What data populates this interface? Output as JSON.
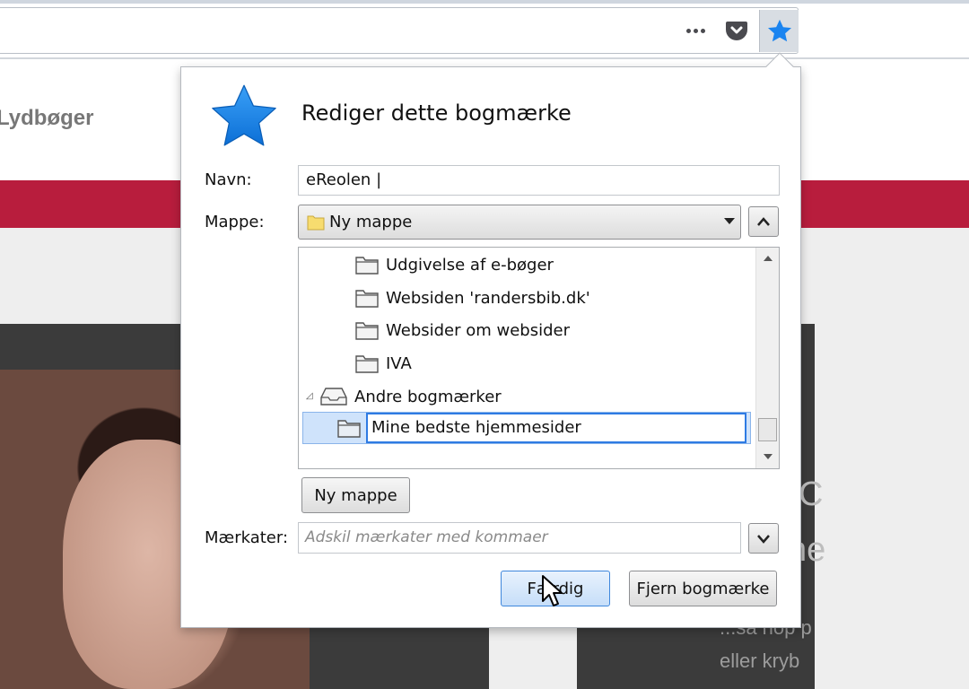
{
  "page_behind": {
    "nav_text": "Lydbøger",
    "right_heading_1": "C",
    "right_heading_2": "ne",
    "right_text_1": "...så hop p",
    "right_text_2": "eller kryb"
  },
  "toolbar": {
    "more_icon": "ellipsis-icon",
    "pocket_icon": "pocket-icon",
    "bookmark_icon": "star-icon",
    "accent_color": "#1a84f0"
  },
  "bookmark_panel": {
    "title": "Rediger dette bogmærke",
    "name_label": "Navn:",
    "name_value": "eReolen |",
    "folder_label": "Mappe:",
    "folder_selected": "Ny mappe",
    "tree": [
      {
        "label": "Udgivelse af e-bøger",
        "level": 2
      },
      {
        "label": "Websiden 'randersbib.dk'",
        "level": 2
      },
      {
        "label": "Websider om websider",
        "level": 2
      },
      {
        "label": "IVA",
        "level": 2
      },
      {
        "label": "Andre bogmærker",
        "level": 1,
        "expanded": true
      },
      {
        "label": "Mine bedste hjemmesider",
        "level": 2,
        "selected": true,
        "editing": true
      }
    ],
    "new_folder_button": "Ny mappe",
    "tags_label": "Mærkater:",
    "tags_placeholder": "Adskil mærkater med kommaer",
    "done_button": "Færdig",
    "remove_button": "Fjern bogmærke"
  }
}
